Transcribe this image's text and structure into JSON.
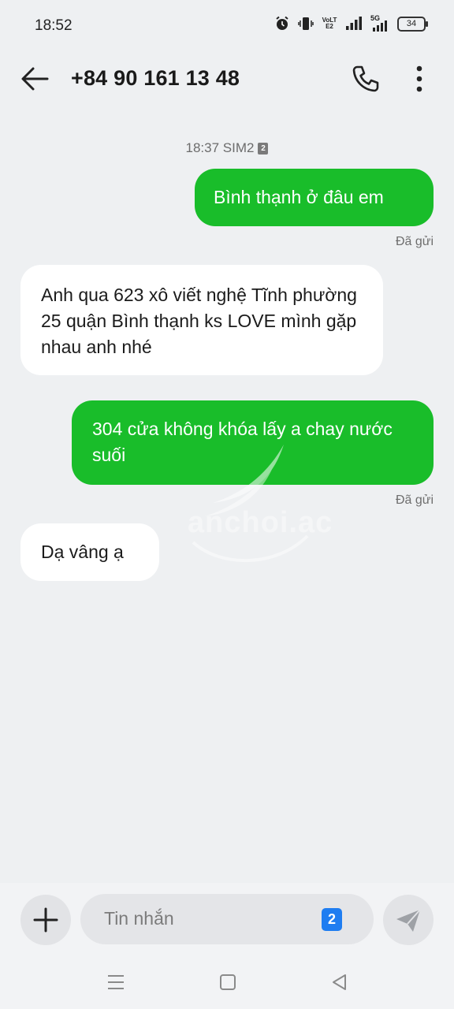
{
  "status": {
    "time": "18:52",
    "volte": "VoLTE2",
    "net": "5G",
    "battery": "34"
  },
  "header": {
    "contact": "+84 90 161 13 48"
  },
  "thread": {
    "timestamp": "18:37 SIM2",
    "sim_badge": "2",
    "messages": [
      {
        "dir": "sent",
        "text": "Bình thạnh ở đâu em",
        "status": "Đã gửi"
      },
      {
        "dir": "recv",
        "text": "Anh qua 623 xô viết nghệ Tĩnh phường 25 quận Bình thạnh ks LOVE mình gặp nhau anh nhé"
      },
      {
        "dir": "sent",
        "text": "304 cửa không khóa lấy a chay nước suối",
        "status": "Đã gửi"
      },
      {
        "dir": "recv",
        "text": "Dạ vâng ạ"
      }
    ]
  },
  "watermark": "anchoi.ac",
  "composer": {
    "placeholder": "Tin nhắn",
    "sim": "2"
  },
  "colors": {
    "sent_bubble": "#19bd2a",
    "recv_bubble": "#ffffff",
    "background": "#eef0f2",
    "sim_indicator": "#1f7df1"
  },
  "icons": {
    "back": "arrow-left-icon",
    "call": "phone-icon",
    "more": "more-vertical-icon",
    "add": "plus-icon",
    "send": "send-icon"
  }
}
